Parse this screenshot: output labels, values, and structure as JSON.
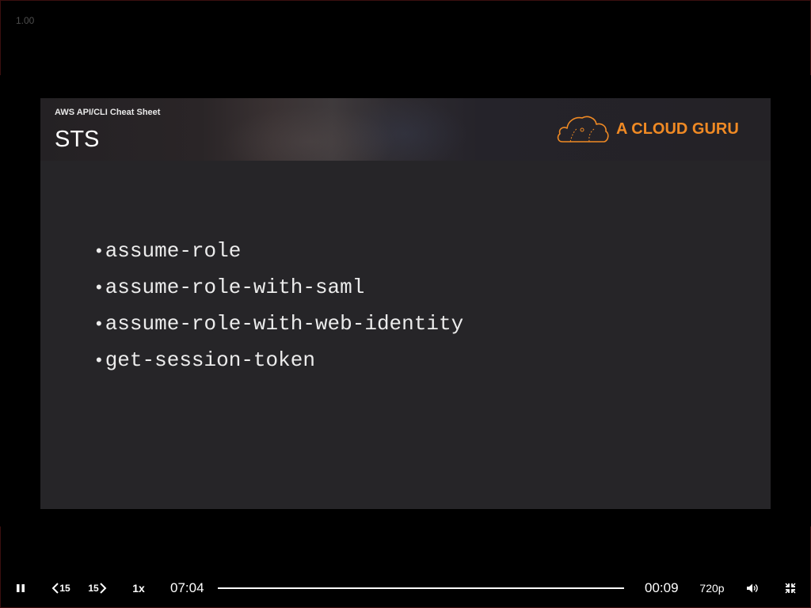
{
  "overlay": {
    "rate_readout": "1.00"
  },
  "slide": {
    "subtitle": "AWS API/CLI Cheat Sheet",
    "title": "STS",
    "logo_text": "A CLOUD GURU",
    "bullets": [
      "assume-role",
      "assume-role-with-saml",
      "assume-role-with-web-identity",
      "get-session-token"
    ],
    "bullet_glyph": "•"
  },
  "player": {
    "play_state_icon": "pause-icon",
    "skip_back_label": "15",
    "skip_forward_label": "15",
    "speed_label": "1x",
    "current_time": "07:04",
    "remaining_time": "00:09",
    "quality_label": "720p",
    "progress_fraction": 0.98,
    "volume_icon": "volume-icon",
    "exit_fullscreen_icon": "exit-fullscreen-icon"
  },
  "colors": {
    "brand_orange": "#f08a24",
    "slide_background": "#262528",
    "player_background": "#000000"
  }
}
